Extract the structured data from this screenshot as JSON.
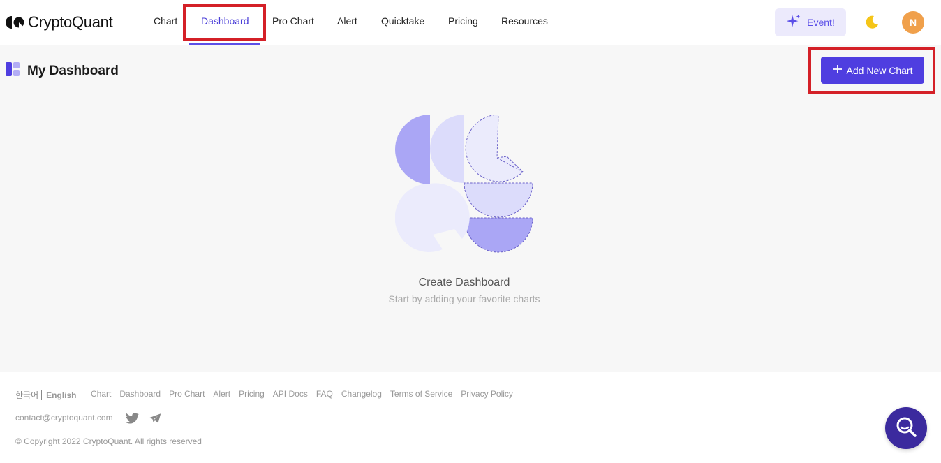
{
  "brand": {
    "name": "CryptoQuant"
  },
  "nav": {
    "items": [
      {
        "label": "Chart"
      },
      {
        "label": "Dashboard",
        "active": true
      },
      {
        "label": "Pro Chart"
      },
      {
        "label": "Alert"
      },
      {
        "label": "Quicktake"
      },
      {
        "label": "Pricing"
      },
      {
        "label": "Resources"
      }
    ]
  },
  "header_actions": {
    "event_label": "Event!",
    "event_icon": "sparkle-icon",
    "theme_icon": "moon-icon",
    "avatar_initial": "N"
  },
  "dashboard": {
    "title": "My Dashboard",
    "add_button_label": "Add New Chart",
    "empty_title": "Create Dashboard",
    "empty_subtitle": "Start by adding your favorite charts"
  },
  "footer": {
    "lang_korean": "한국어",
    "lang_english": "English",
    "links": [
      "Chart",
      "Dashboard",
      "Pro Chart",
      "Alert",
      "Pricing",
      "API Docs",
      "FAQ",
      "Changelog",
      "Terms of Service",
      "Privacy Policy"
    ],
    "contact": "contact@cryptoquant.com",
    "copyright": "© Copyright 2022 CryptoQuant. All rights reserved"
  },
  "colors": {
    "accent": "#4f3ee0",
    "highlight": "#d42027",
    "avatar": "#f0a04b",
    "fab": "#3b2a9e"
  }
}
